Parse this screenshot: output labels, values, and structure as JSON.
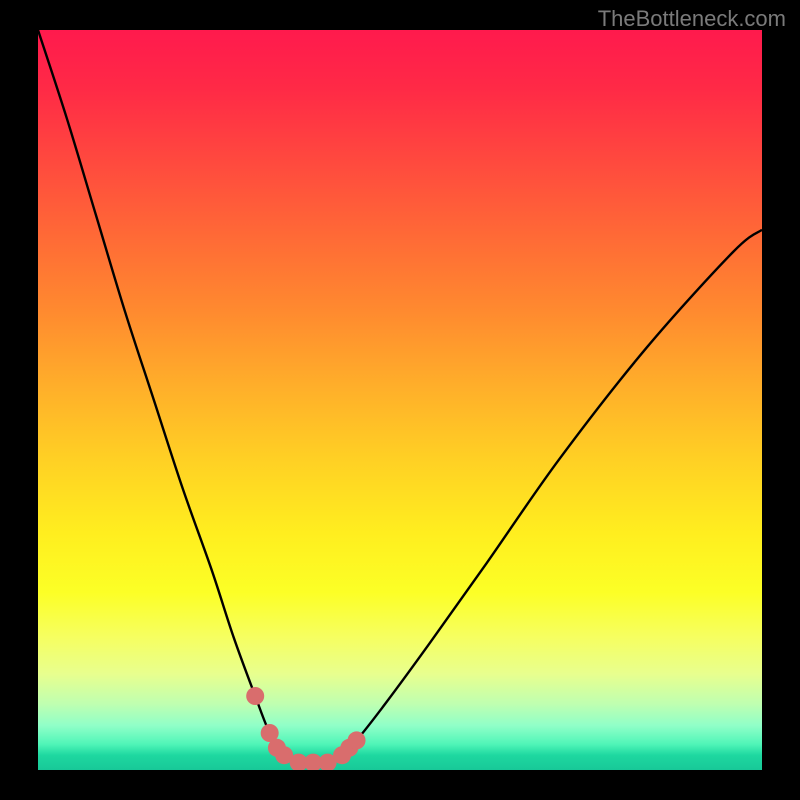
{
  "watermark": "TheBottleneck.com",
  "chart_data": {
    "type": "line",
    "title": "",
    "xlabel": "",
    "ylabel": "",
    "xlim": [
      0,
      100
    ],
    "ylim": [
      0,
      100
    ],
    "grid": false,
    "legend": false,
    "description": "V-shaped bottleneck curve over a vertical rainbow risk gradient (red=high at top, green=low at bottom). Optimal zone is the trough near x≈32–42.",
    "series": [
      {
        "name": "bottleneck-curve",
        "x": [
          0,
          4,
          8,
          12,
          16,
          20,
          24,
          27,
          30,
          32,
          34,
          36,
          38,
          40,
          42,
          44,
          48,
          54,
          62,
          72,
          84,
          96,
          100
        ],
        "values": [
          100,
          88,
          75,
          62,
          50,
          38,
          27,
          18,
          10,
          5,
          2,
          1,
          1,
          1,
          2,
          4,
          9,
          17,
          28,
          42,
          57,
          70,
          73
        ]
      }
    ],
    "highlight_points": {
      "name": "optimal-range-dots",
      "x": [
        30,
        32,
        33,
        34,
        36,
        38,
        40,
        42,
        43,
        44
      ],
      "values": [
        10,
        5,
        3,
        2,
        1,
        1,
        1,
        2,
        3,
        4
      ],
      "color": "#d96d6d"
    },
    "gradient_stops": [
      {
        "pos": 0.0,
        "color": "#ff1a4d"
      },
      {
        "pos": 0.5,
        "color": "#ffd024"
      },
      {
        "pos": 0.8,
        "color": "#fcff26"
      },
      {
        "pos": 0.95,
        "color": "#50f5b8"
      },
      {
        "pos": 1.0,
        "color": "#18c898"
      }
    ]
  }
}
